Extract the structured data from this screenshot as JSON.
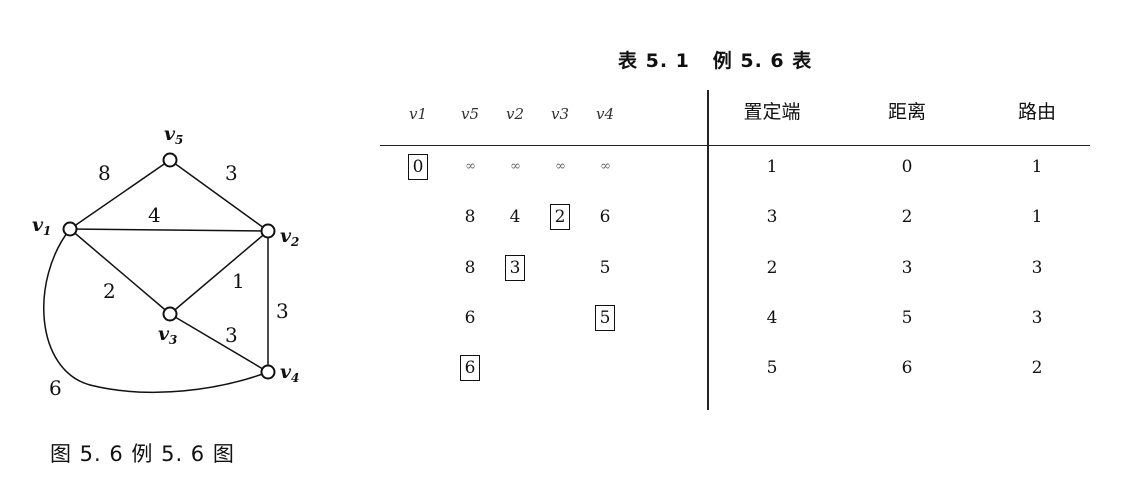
{
  "graph": {
    "nodes": [
      {
        "id": "v1",
        "label": "v"
      },
      {
        "id": "v5",
        "label": "v"
      },
      {
        "id": "v2",
        "label": "v"
      },
      {
        "id": "v3",
        "label": "v"
      },
      {
        "id": "v4",
        "label": "v"
      }
    ],
    "node_subscripts": [
      "1",
      "5",
      "2",
      "3",
      "4"
    ],
    "edges": [
      {
        "from": "v1",
        "to": "v5",
        "weight": "8"
      },
      {
        "from": "v5",
        "to": "v2",
        "weight": "3"
      },
      {
        "from": "v1",
        "to": "v2",
        "weight": "4"
      },
      {
        "from": "v1",
        "to": "v3",
        "weight": "2"
      },
      {
        "from": "v3",
        "to": "v2",
        "weight": "1"
      },
      {
        "from": "v2",
        "to": "v4",
        "weight": "3"
      },
      {
        "from": "v3",
        "to": "v4",
        "weight": "3"
      },
      {
        "from": "v1",
        "to": "v4",
        "weight": "6"
      }
    ],
    "caption": "图 5. 6   例 5. 6 图"
  },
  "table": {
    "caption": "表 5. 1   例 5. 6 表",
    "left_headers": [
      "v1",
      "v5",
      "v2",
      "v3",
      "v4"
    ],
    "right_headers": [
      "置定端",
      "距离",
      "路由"
    ],
    "left_rows": [
      [
        "0",
        "∞",
        "∞",
        "∞",
        "∞"
      ],
      [
        "",
        "8",
        "4",
        "2",
        "6"
      ],
      [
        "",
        "8",
        "3",
        "",
        "5"
      ],
      [
        "",
        "6",
        "",
        "",
        "5"
      ],
      [
        "",
        "6",
        "",
        "",
        ""
      ]
    ],
    "boxed_cells": [
      [
        0,
        0
      ],
      [
        1,
        3
      ],
      [
        2,
        2
      ],
      [
        3,
        4
      ],
      [
        4,
        1
      ]
    ],
    "right_rows": [
      [
        "1",
        "0",
        "1"
      ],
      [
        "3",
        "2",
        "1"
      ],
      [
        "2",
        "3",
        "3"
      ],
      [
        "4",
        "5",
        "3"
      ],
      [
        "5",
        "6",
        "2"
      ]
    ]
  }
}
